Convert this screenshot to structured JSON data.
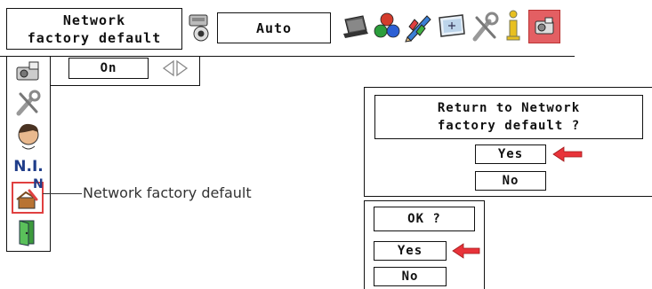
{
  "menu_bar": {
    "title_line1": "Network",
    "title_line2": "factory default",
    "mode_value": "Auto",
    "icons": [
      "projector-settings-icon",
      "laptop-icon",
      "color-balls-icon",
      "color-pencil-icon",
      "screen-icon",
      "wrench-icon",
      "info-icon",
      "network-projector-icon"
    ]
  },
  "sidebar": {
    "icons": [
      "network-settings-icon",
      "wrench-icon",
      "person-icon",
      "network-info-icon",
      "network-factory-default-icon",
      "exit-door-icon"
    ],
    "ni_label": "N.I.",
    "badge_letter": "N"
  },
  "submenu": {
    "value": "On"
  },
  "callout": {
    "label": "Network factory default"
  },
  "dialog_return": {
    "question_line1": "Return to Network",
    "question_line2": "factory default ?",
    "yes": "Yes",
    "no": "No"
  },
  "dialog_ok": {
    "question": "OK ?",
    "yes": "Yes",
    "no": "No"
  },
  "colors": {
    "arrow": "#e8333a",
    "border": "#111111"
  }
}
